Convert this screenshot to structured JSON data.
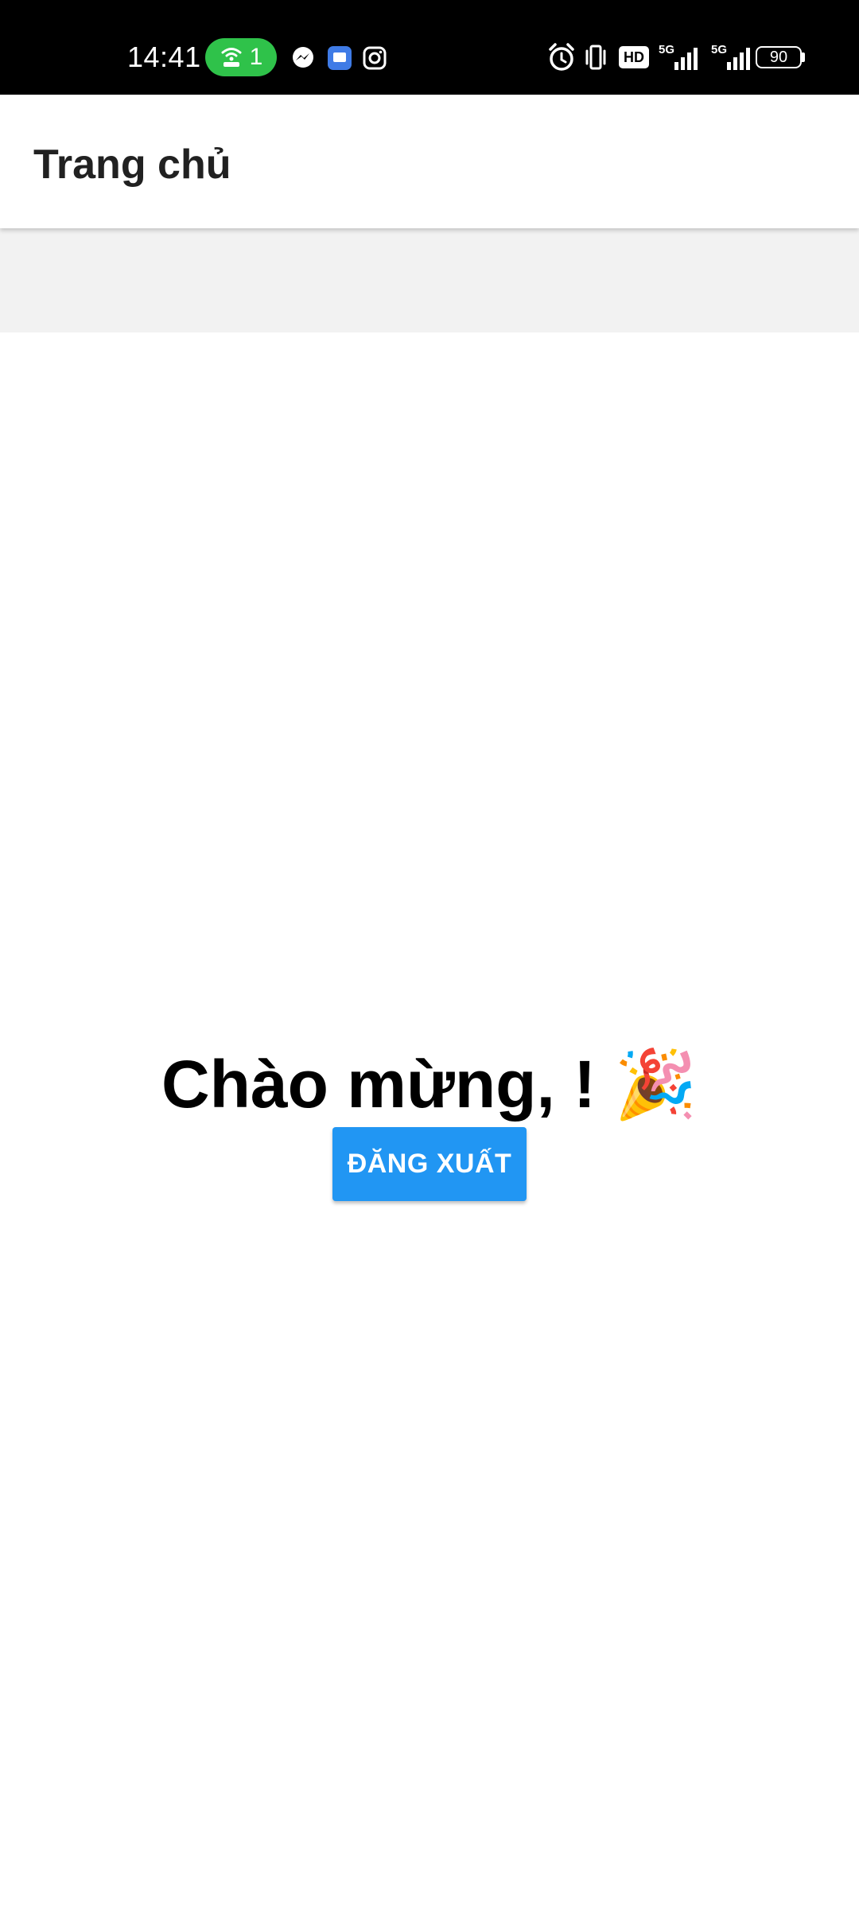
{
  "status_bar": {
    "time": "14:41",
    "hotspot_count": "1",
    "battery": "90",
    "hd_label": "HD",
    "network_1": "5G",
    "network_2": "5G",
    "colors": {
      "background": "#000000",
      "hotspot_pill": "#2fc24a",
      "text": "#ffffff"
    },
    "left_icons": [
      "hotspot-icon",
      "messenger-icon",
      "message-app-icon",
      "instagram-icon"
    ],
    "right_icons": [
      "alarm-icon",
      "vibrate-icon",
      "hd-voice-icon",
      "signal-5g-icon",
      "signal-5g-icon",
      "battery-icon"
    ]
  },
  "app_bar": {
    "title": "Trang chủ"
  },
  "main": {
    "welcome_text": "Chào mừng, ! 🎉",
    "logout_label": "ĐĂNG XUẤT"
  },
  "colors": {
    "primary": "#2196f3",
    "title_text": "#212121",
    "band": "#f2f2f2"
  }
}
